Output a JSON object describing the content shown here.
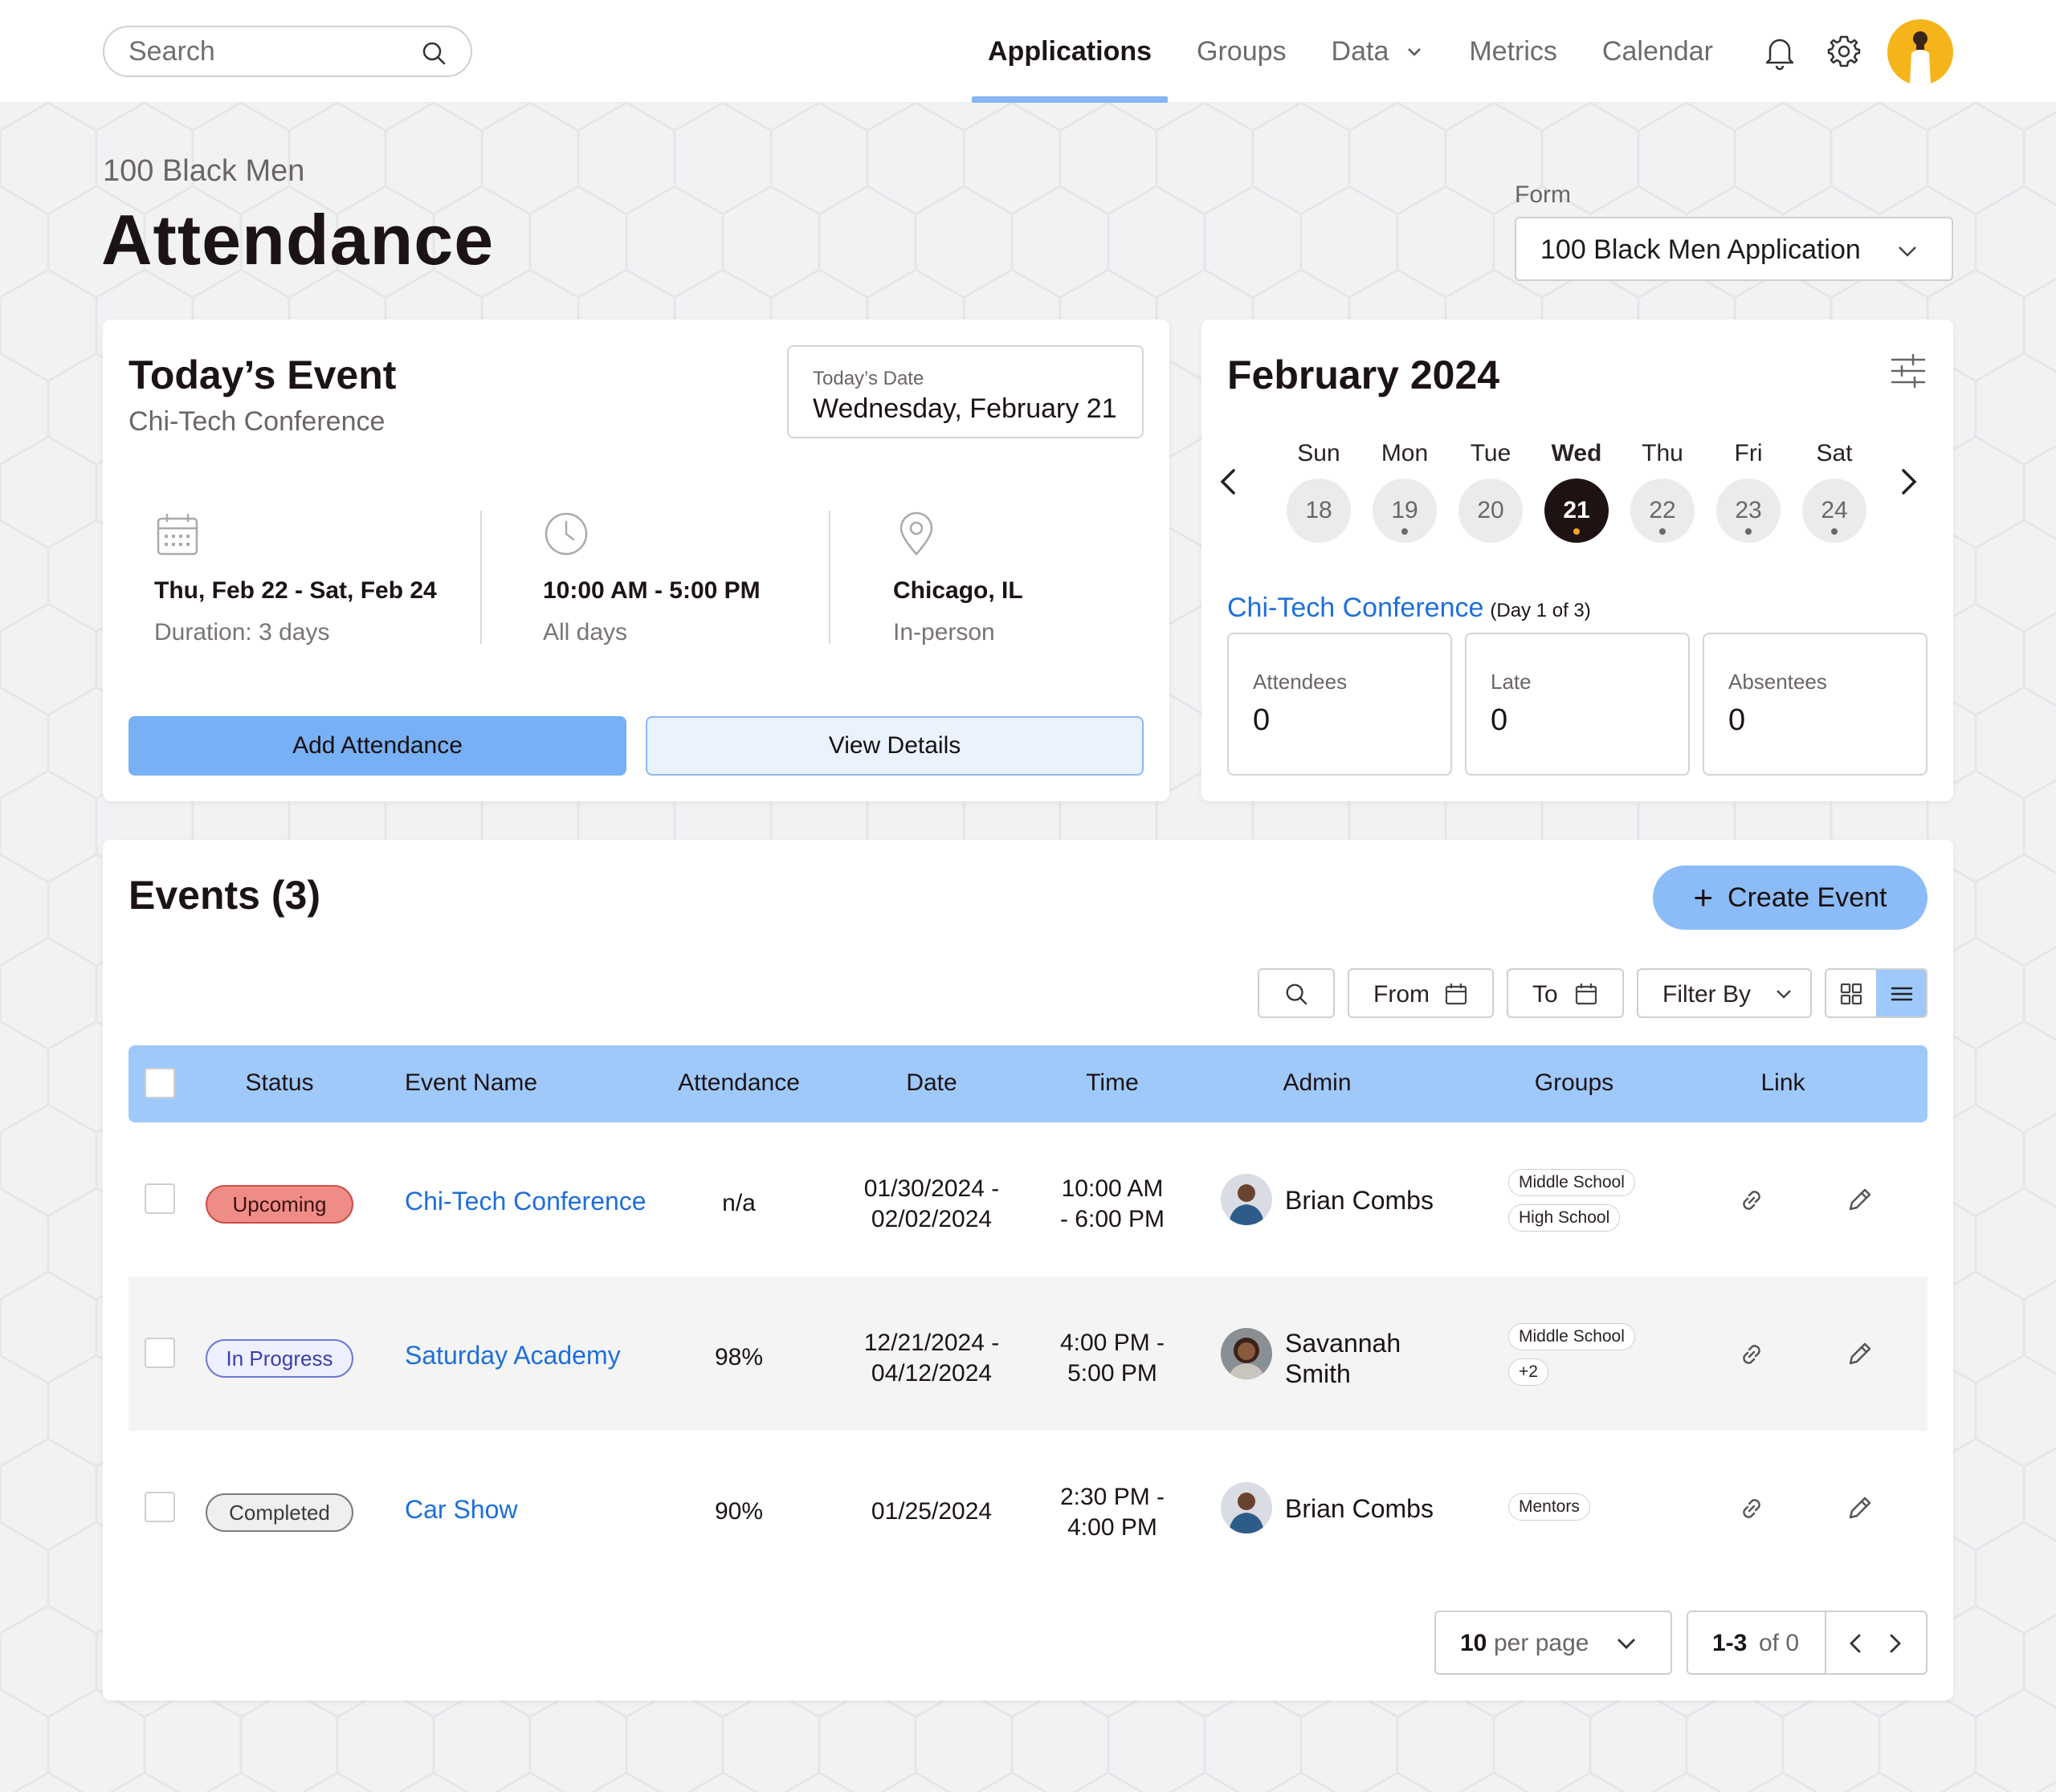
{
  "header": {
    "search_placeholder": "Search",
    "nav": [
      {
        "label": "Applications",
        "active": true
      },
      {
        "label": "Groups"
      },
      {
        "label": "Data",
        "has_dropdown": true
      },
      {
        "label": "Metrics"
      },
      {
        "label": "Calendar"
      }
    ],
    "icons": [
      "bell-icon",
      "gear-icon",
      "avatar"
    ]
  },
  "page": {
    "org_name": "100 Black Men",
    "title": "Attendance",
    "form_label": "Form",
    "form_value": "100 Black Men Application"
  },
  "today": {
    "title": "Today’s Event",
    "event_name": "Chi-Tech Conference",
    "date_label": "Today’s Date",
    "date_value": "Wednesday, February 21",
    "dates": "Thu, Feb 22 - Sat, Feb 24",
    "duration": "Duration: 3 days",
    "time": "10:00 AM - 5:00 PM",
    "time_meta": "All days",
    "location": "Chicago, IL",
    "location_meta": "In-person",
    "add_button": "Add Attendance",
    "view_button": "View Details"
  },
  "calendar": {
    "month": "February 2024",
    "days": [
      {
        "name": "Sun",
        "num": "18",
        "dot": false
      },
      {
        "name": "Mon",
        "num": "19",
        "dot": true
      },
      {
        "name": "Tue",
        "num": "20",
        "dot": false
      },
      {
        "name": "Wed",
        "num": "21",
        "dot": true,
        "active": true
      },
      {
        "name": "Thu",
        "num": "22",
        "dot": true
      },
      {
        "name": "Fri",
        "num": "23",
        "dot": true
      },
      {
        "name": "Sat",
        "num": "24",
        "dot": true
      }
    ],
    "event_name": "Chi-Tech Conference",
    "event_day": "(Day 1 of 3)",
    "stats": [
      {
        "label": "Attendees",
        "value": "0"
      },
      {
        "label": "Late",
        "value": "0"
      },
      {
        "label": "Absentees",
        "value": "0"
      }
    ]
  },
  "events": {
    "title": "Events (3)",
    "create_button": "Create Event",
    "toolbar": {
      "from": "From",
      "to": "To",
      "filter": "Filter By"
    },
    "columns": [
      "Status",
      "Event Name",
      "Attendance",
      "Date",
      "Time",
      "Admin",
      "Groups",
      "Link"
    ],
    "rows": [
      {
        "status": "Upcoming",
        "status_type": "upcoming",
        "name": "Chi-Tech Conference",
        "attendance": "n/a",
        "date1": "01/30/2024 -",
        "date2": "02/02/2024",
        "time1": "10:00 AM",
        "time2": "- 6:00 PM",
        "admin1": "Brian Combs",
        "admin2": "",
        "groups": [
          "Middle School",
          "High School"
        ]
      },
      {
        "status": "In Progress",
        "status_type": "progress",
        "name": "Saturday Academy",
        "attendance": "98%",
        "date1": "12/21/2024 -",
        "date2": "04/12/2024",
        "time1": "4:00 PM -",
        "time2": "5:00 PM",
        "admin1": "Savannah",
        "admin2": "Smith",
        "groups": [
          "Middle School",
          "+2"
        ]
      },
      {
        "status": "Completed",
        "status_type": "completed",
        "name": "Car Show",
        "attendance": "90%",
        "date1": "01/25/2024",
        "date2": "",
        "time1": "2:30 PM -",
        "time2": "4:00 PM",
        "admin1": "Brian Combs",
        "admin2": "",
        "groups": [
          "Mentors"
        ]
      }
    ],
    "pagination": {
      "per_page_num": "10",
      "per_page_suffix": "per page",
      "range": "1-3",
      "of": "of 0"
    }
  },
  "colors": {
    "accent": "#77b0f5",
    "link": "#1e6fd9",
    "active_day": "#1f1212"
  }
}
